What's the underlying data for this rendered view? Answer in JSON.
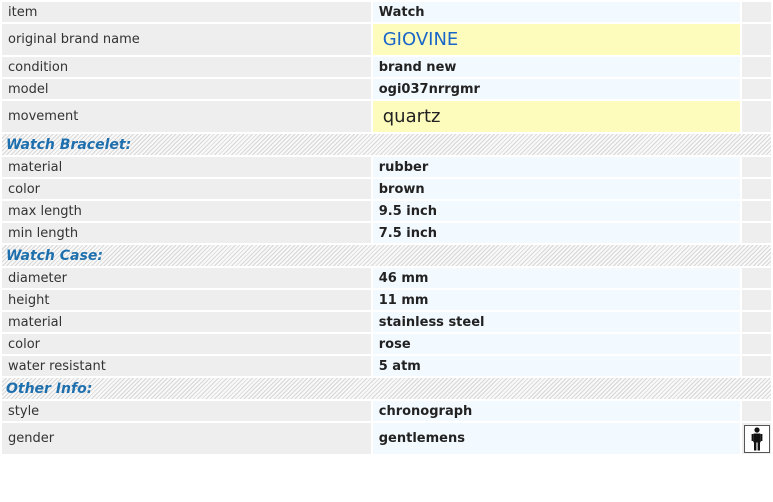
{
  "rows": {
    "item": {
      "label": "item",
      "value": "Watch"
    },
    "brand": {
      "label": "original brand name",
      "value": "GIOVINE"
    },
    "condition": {
      "label": "condition",
      "value": "brand new"
    },
    "model": {
      "label": "model",
      "value": "ogi037nrrgmr"
    },
    "movement": {
      "label": "movement",
      "value": "quartz"
    }
  },
  "bracelet": {
    "heading": "Watch Bracelet:",
    "material": {
      "label": "material",
      "value": "rubber"
    },
    "color": {
      "label": "color",
      "value": "brown"
    },
    "max_length": {
      "label": "max length",
      "value": "9.5 inch"
    },
    "min_length": {
      "label": "min length",
      "value": "7.5 inch"
    }
  },
  "case": {
    "heading": "Watch Case:",
    "diameter": {
      "label": "diameter",
      "value": "46 mm"
    },
    "height": {
      "label": "height",
      "value": "11 mm"
    },
    "material": {
      "label": "material",
      "value": "stainless steel"
    },
    "color": {
      "label": "color",
      "value": "rose"
    },
    "water_resistant": {
      "label": "water resistant",
      "value": "5 atm"
    }
  },
  "other": {
    "heading": "Other Info:",
    "style": {
      "label": "style",
      "value": "chronograph"
    },
    "gender": {
      "label": "gender",
      "value": "gentlemens",
      "icon": "male-person-icon"
    }
  },
  "colors": {
    "heading_text": "#1e6fae",
    "label_bg": "#eeeeee",
    "value_bg": "#f2f9ff",
    "highlight_bg": "#fefcbd",
    "brand_text": "#1a66c9"
  }
}
